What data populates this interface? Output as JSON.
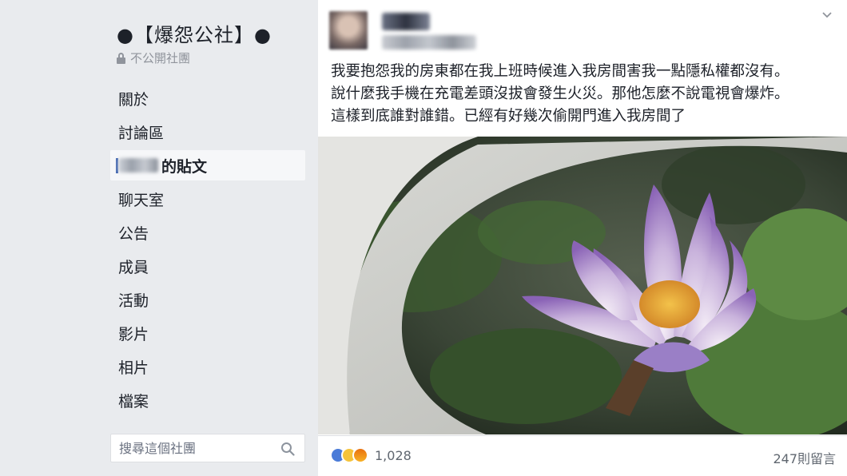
{
  "sidebar": {
    "group_title": "●【爆怨公社】●",
    "privacy_label": "不公開社團",
    "nav_items": [
      "關於",
      "討論區",
      "的貼文",
      "聊天室",
      "公告",
      "成員",
      "活動",
      "影片",
      "相片",
      "檔案"
    ],
    "search_placeholder": "搜尋這個社團"
  },
  "post": {
    "text_lines": [
      "我要抱怨我的房東都在我上班時候進入我房間害我一點隱私權都沒有。",
      "說什麼我手機在充電差頭沒拔會發生火災。那他怎麼不說電視會爆炸。",
      "這樣到底誰對誰錯。已經有好幾次偷開門進入我房間了"
    ],
    "reaction_count": "1,028",
    "comment_count": "247則留言"
  },
  "colors": {
    "accent": "#4267b2",
    "background": "#e9ebee",
    "text": "#1d2129",
    "muted": "#90949c"
  },
  "icons": [
    "lock-icon",
    "search-icon",
    "chevron-down-icon",
    "like-icon",
    "wow-icon",
    "angry-icon"
  ]
}
